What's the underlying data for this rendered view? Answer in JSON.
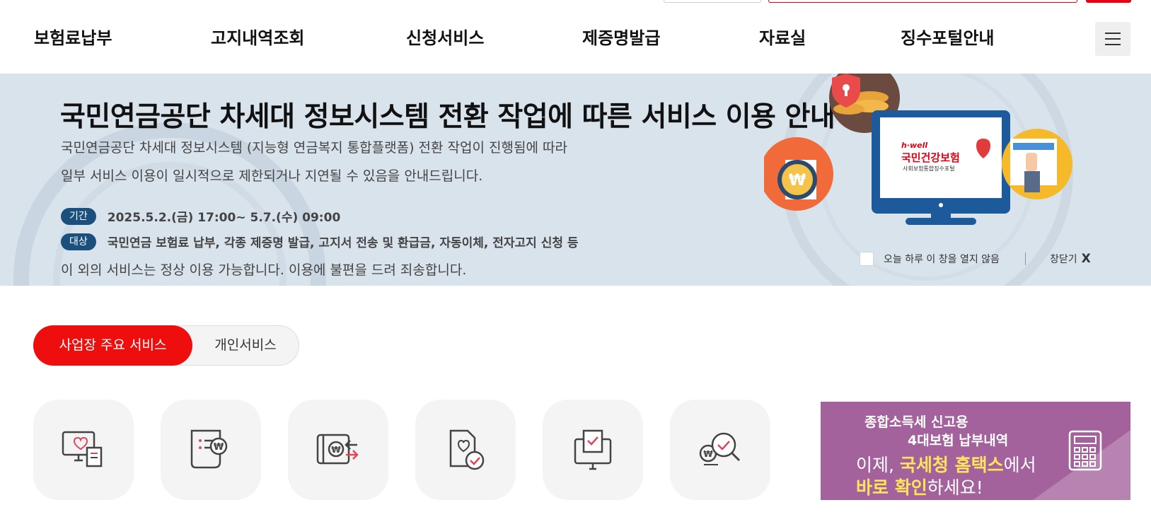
{
  "nav": {
    "items": [
      "보험료납부",
      "고지내역조회",
      "신청서비스",
      "제증명발급",
      "자료실",
      "징수포털안내"
    ],
    "menu_icon": "hamburger-menu-icon"
  },
  "notice": {
    "title": "국민연금공단 차세대 정보시스템 전환 작업에 따른 서비스 이용 안내",
    "desc1": "국민연금공단 차세대 정보시스템 (지능형 연금복지 통합플랫폼) 전환 작업이 진행됨에 따라",
    "desc2": "일부 서비스 이용이 일시적으로 제한되거나 지연될 수 있음을 안내드립니다.",
    "period_label": "기간",
    "period_value": "2025.5.2.(금) 17:00~ 5.7.(수) 09:00",
    "target_label": "대상",
    "target_value": "국민연금 보험료 납부, 각종 제증명 발급, 고지서 전송 및 환급금, 자동이체, 전자고지 신청 등",
    "footer": "이 외의 서비스는 정상 이용 가능합니다. 이용에 불편을 드려 죄송합니다.",
    "brand_small": "h·well",
    "brand_main": "국민건강보험",
    "brand_sub": "사회보험통합징수포털",
    "dismiss_label": "오늘 하루 이 창을 열지 않음",
    "close_label": "창닫기",
    "close_x": "X",
    "colors": {
      "background": "#d9e3ec",
      "pill": "#1b4f7e"
    }
  },
  "service_tabs": {
    "active": "사업장 주요 서비스",
    "inactive": "개인서비스",
    "active_color": "#ee0e0e"
  },
  "quick_icons": [
    "monitor-heart-receipt-icon",
    "document-won-icon",
    "card-transfer-icon",
    "document-check-icon",
    "computer-check-icon",
    "won-search-icon"
  ],
  "promo": {
    "line1": "종합소득세 신고용",
    "line2": "4대보험 납부내역",
    "line3_pre": "이제, ",
    "line3_hl": "국세청 홈택스",
    "line3_post": "에서",
    "line4_hl": "바로 확인",
    "line4_post": "하세요!",
    "icon": "calculator-icon",
    "color": "#a4629c"
  }
}
